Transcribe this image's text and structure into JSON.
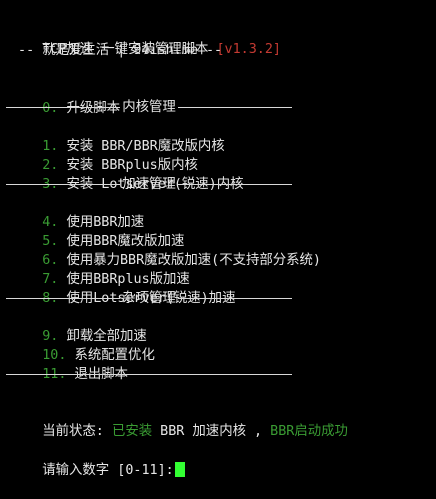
{
  "header": {
    "title": "TCP加速 一键安装管理脚本",
    "version": "[v1.3.2]",
    "subtitle": " -- 就是爱生活 | 94ish.me --"
  },
  "menu": {
    "upgrade": {
      "num": "0.",
      "label": "升级脚本"
    },
    "kernel_section": "内核管理",
    "kernel_items": [
      {
        "num": "1.",
        "label": "安装 BBR/BBR魔改版内核"
      },
      {
        "num": "2.",
        "label": "安装 BBRplus版内核"
      },
      {
        "num": "3.",
        "label": "安装 Lotserver(锐速)内核"
      }
    ],
    "accel_section": "加速管理",
    "accel_items": [
      {
        "num": "4.",
        "label": "使用BBR加速"
      },
      {
        "num": "5.",
        "label": "使用BBR魔改版加速"
      },
      {
        "num": "6.",
        "label": "使用暴力BBR魔改版加速(不支持部分系统)"
      },
      {
        "num": "7.",
        "label": "使用BBRplus版加速"
      },
      {
        "num": "8.",
        "label": "使用Lotserver(锐速)加速"
      }
    ],
    "misc_section": "杂项管理",
    "misc_items": [
      {
        "num": "9.",
        "label": "卸载全部加速"
      },
      {
        "num": "10.",
        "label": "系统配置优化"
      },
      {
        "num": "11.",
        "label": "退出脚本"
      }
    ]
  },
  "status": {
    "label": "当前状态:",
    "installed": "已安装",
    "kernel": "BBR 加速内核 ,",
    "result": "BBR启动成功"
  },
  "prompt": {
    "text": "请输入数字 [0-11]:"
  },
  "colors": {
    "background": "#000000",
    "text": "#e6e6e6",
    "number_green": "#3a9c33",
    "version_red": "#c43a32",
    "cursor": "#33ff33"
  }
}
